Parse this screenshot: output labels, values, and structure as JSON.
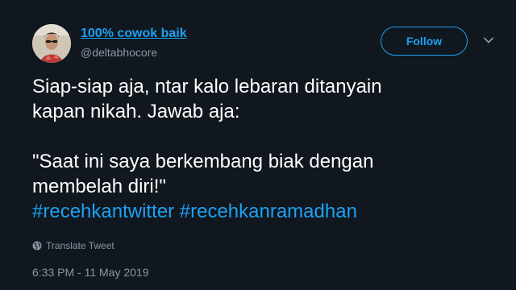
{
  "author": {
    "display_name": "100% cowok baik",
    "handle": "@deltabhocore"
  },
  "follow_button": {
    "label": "Follow"
  },
  "icons": {
    "chevron": "chevron-down-icon",
    "translate": "globe-icon"
  },
  "tweet": {
    "line1": "Siap-siap aja, ntar kalo lebaran ditanyain",
    "line2": "kapan nikah. Jawab aja:",
    "line3": "\"Saat ini saya berkembang biak dengan",
    "line4": "membelah diri!\"",
    "hashtag1": "#recehkantwitter",
    "hashtag2": "#recehkanramadhan"
  },
  "translate_label": "Translate Tweet",
  "timestamp": "6:33 PM - 11 May 2019",
  "colors": {
    "background": "#10171e",
    "accent": "#1da1f2",
    "secondary_text": "#8899a6",
    "primary_text": "#ffffff"
  }
}
